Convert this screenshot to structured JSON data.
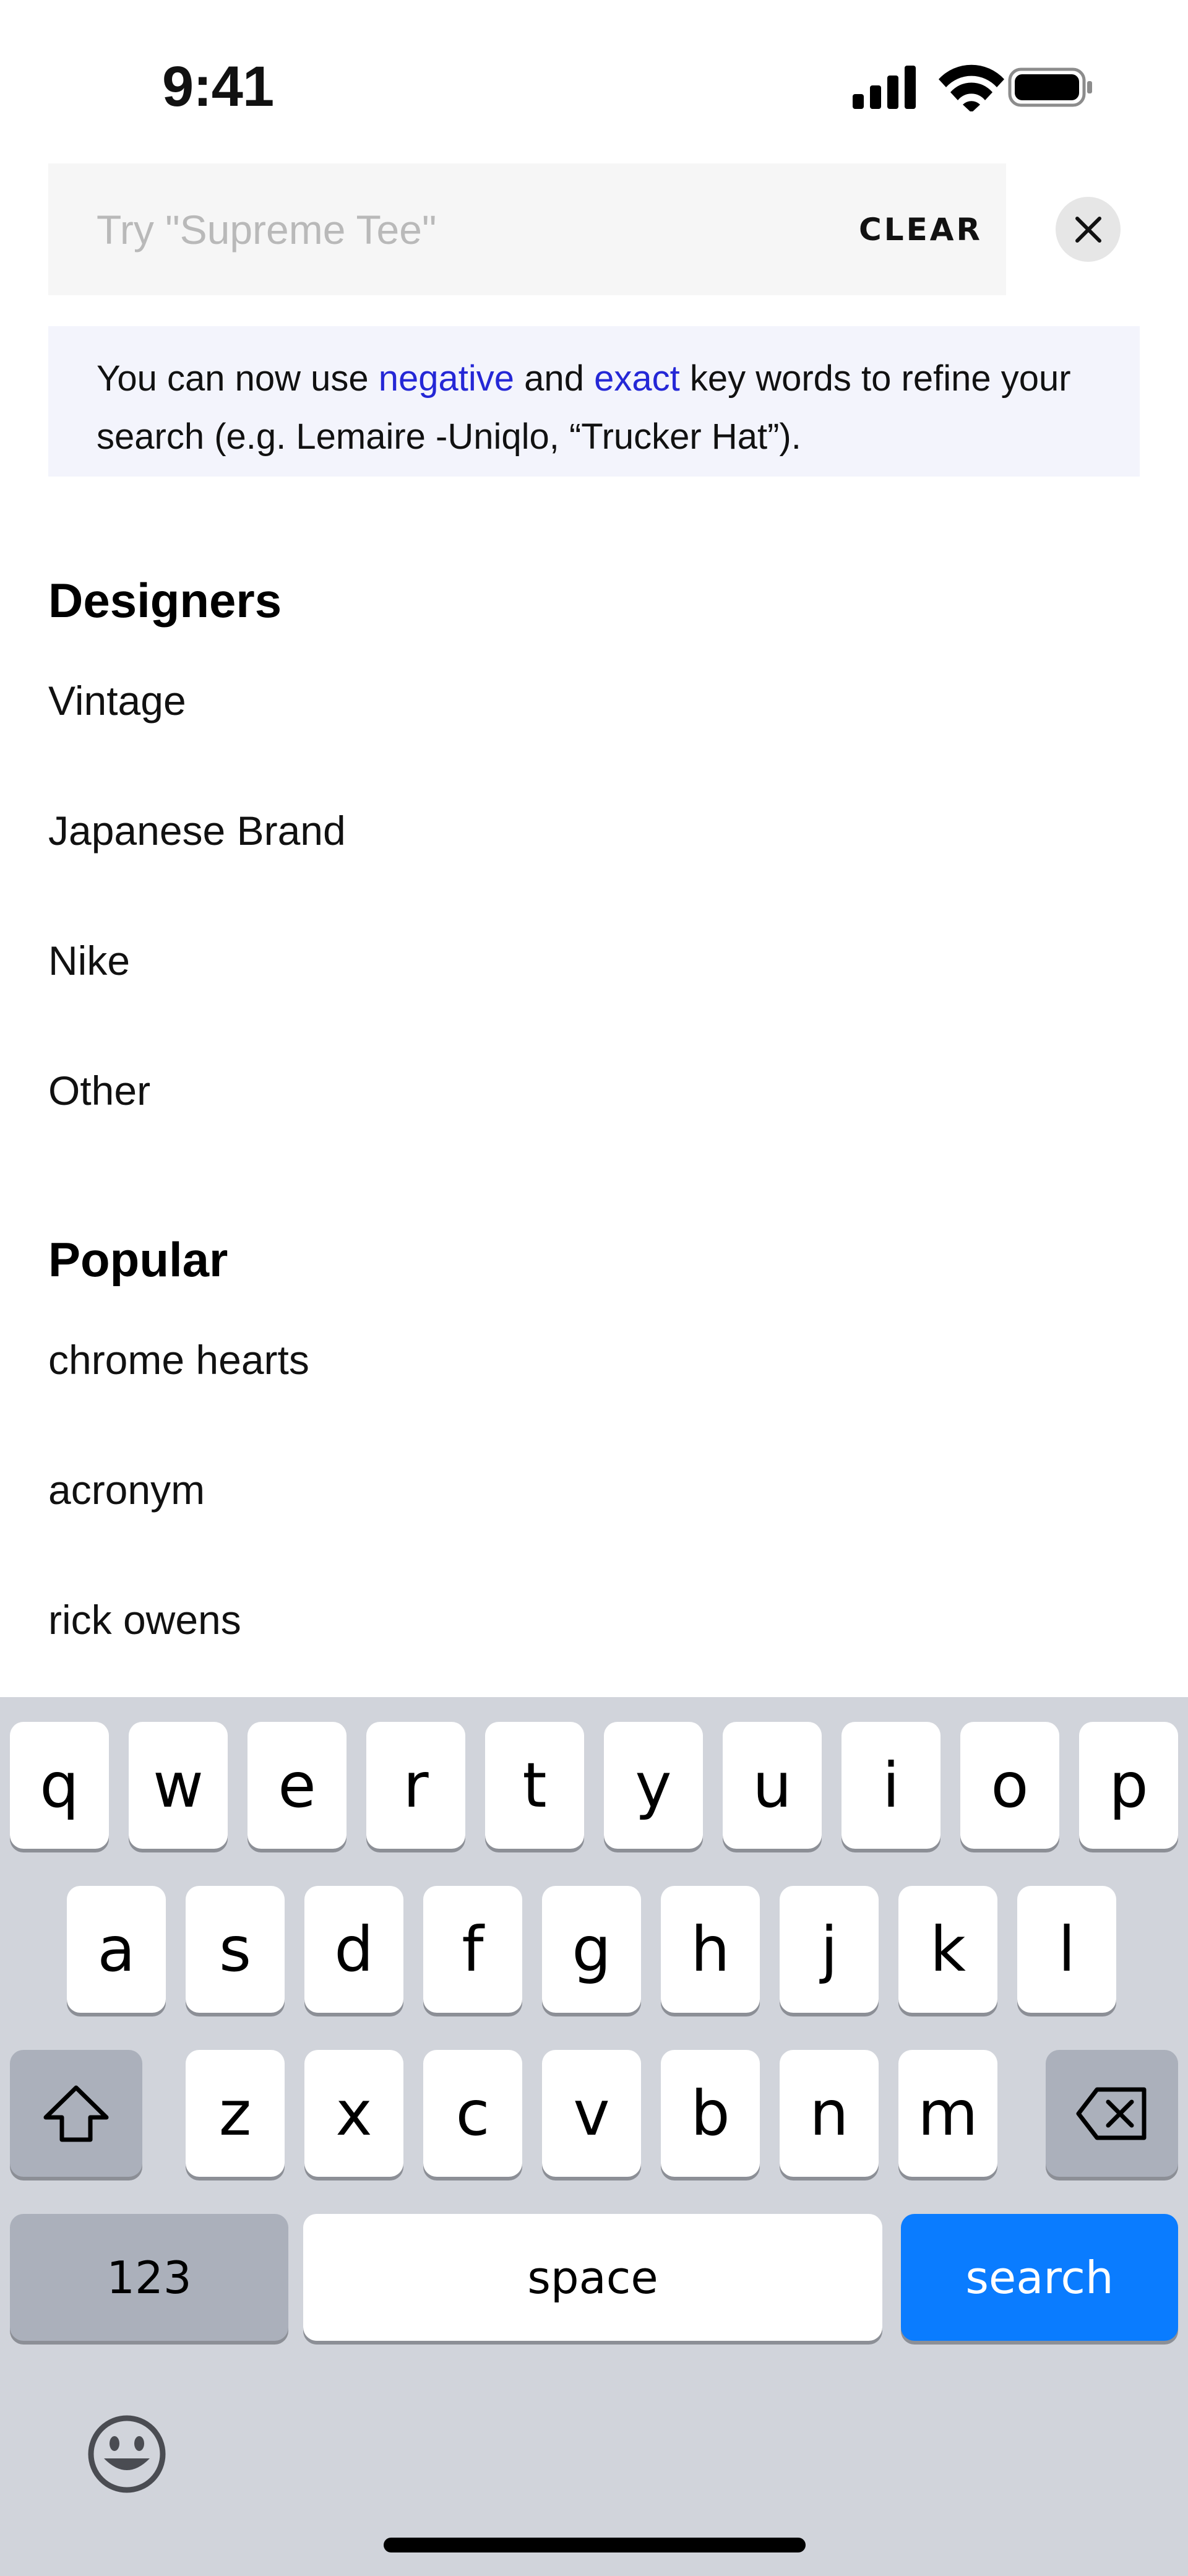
{
  "status_bar": {
    "time": "9:41",
    "icons": [
      "cellular-signal-icon",
      "wifi-icon",
      "battery-icon"
    ]
  },
  "search": {
    "placeholder": "Try \"Supreme Tee\"",
    "value": "",
    "clear_label": "CLEAR",
    "close_icon": "close-icon"
  },
  "tip": {
    "part1": "You can now use ",
    "negative": "negative",
    "part2": " and ",
    "exact": "exact",
    "part3": " key words to refine your search (e.g. Lemaire -Uniqlo,  “Trucker Hat”).",
    "link_color": "#2427d6"
  },
  "designers": {
    "heading": "Designers",
    "items": [
      "Vintage",
      "Japanese Brand",
      "Nike",
      "Other"
    ]
  },
  "popular": {
    "heading": "Popular",
    "items": [
      "chrome hearts",
      "acronym",
      "rick owens"
    ]
  },
  "keyboard": {
    "row1": [
      "q",
      "w",
      "e",
      "r",
      "t",
      "y",
      "u",
      "i",
      "o",
      "p"
    ],
    "row2": [
      "a",
      "s",
      "d",
      "f",
      "g",
      "h",
      "j",
      "k",
      "l"
    ],
    "row3": [
      "z",
      "x",
      "c",
      "v",
      "b",
      "n",
      "m"
    ],
    "numbers_label": "123",
    "space_label": "space",
    "search_label": "search",
    "search_color": "#0a7cff",
    "icons": [
      "shift-icon",
      "backspace-icon",
      "emoji-icon"
    ]
  }
}
